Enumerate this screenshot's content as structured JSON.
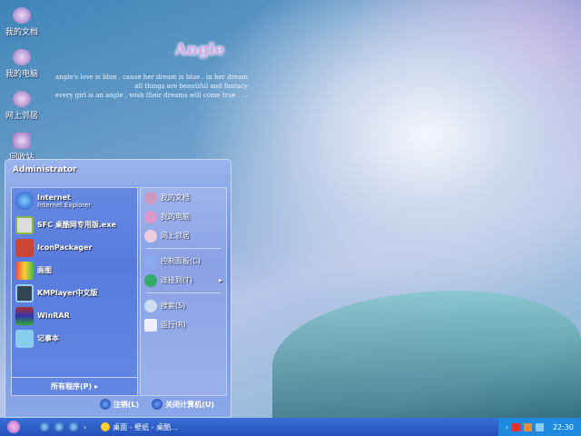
{
  "desktop": {
    "icons": [
      {
        "label": "我的文档"
      },
      {
        "label": "我的电脑"
      },
      {
        "label": "网上邻居"
      },
      {
        "label": "回收站"
      }
    ],
    "wallpaper": {
      "logo": "Angle",
      "quote": [
        "angle's love is blue . cause her dream is blue . in her dream",
        "all things are beautiful and fantacy",
        "every girl is an angle . wish their dreams will come true . . ."
      ]
    }
  },
  "start_menu": {
    "user": "Administrator",
    "programs": [
      {
        "title": "Internet",
        "subtitle": "Internet Explorer",
        "icon": "ie-icon"
      },
      {
        "title": "SFC 桌酷网专用版.exe",
        "icon": "sfc-icon"
      },
      {
        "title": "IconPackager",
        "icon": "iconpackager-icon"
      },
      {
        "title": "画图",
        "icon": "paint-icon"
      },
      {
        "title": "KMPlayer中文版",
        "icon": "kmplayer-icon"
      },
      {
        "title": "WinRAR",
        "icon": "winrar-icon"
      },
      {
        "title": "记事本",
        "icon": "notepad-icon"
      }
    ],
    "all_programs": "所有程序(P)",
    "places": [
      {
        "label": "我的文档"
      },
      {
        "label": "我的电脑"
      },
      {
        "label": "网上邻居"
      },
      {
        "label": "控制面板(C)"
      },
      {
        "label": "连接到(T)"
      },
      {
        "label": "搜索(S)"
      },
      {
        "label": "运行(R)"
      }
    ],
    "logoff": "注销(L)",
    "shutdown": "关闭计算机(U)"
  },
  "taskbar": {
    "task": "桌面 - 壁纸 - 桌酷...",
    "clock": "22:30"
  }
}
